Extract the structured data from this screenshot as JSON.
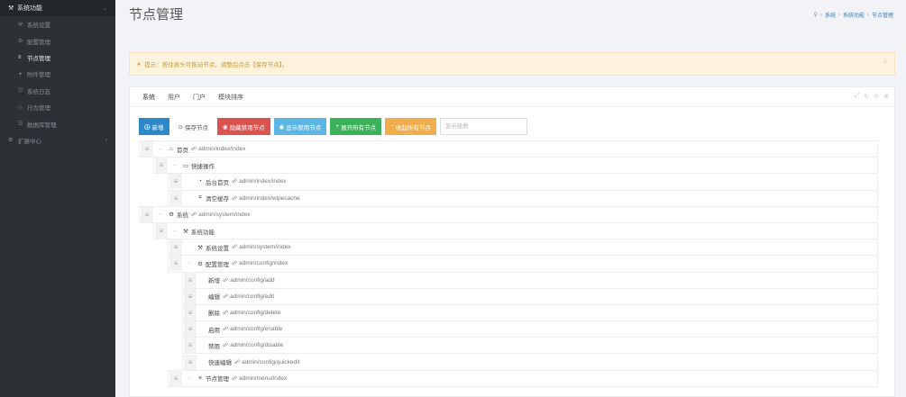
{
  "sidebar": {
    "header": {
      "icon": "wrench-icon",
      "label": "系统功能",
      "arrow": "⌄"
    },
    "items": [
      {
        "icon": "wrench-icon",
        "label": "系统设置",
        "active": false
      },
      {
        "icon": "gear-icon",
        "label": "配置管理",
        "active": false
      },
      {
        "icon": "list-icon",
        "label": "节点管理",
        "active": true
      },
      {
        "icon": "puzzle-icon",
        "label": "附件管理",
        "active": false
      },
      {
        "icon": "file-icon",
        "label": "系统日志",
        "active": false
      },
      {
        "icon": "shield-icon",
        "label": "行为管理",
        "active": false
      },
      {
        "icon": "db-icon",
        "label": "数据库管理",
        "active": false
      }
    ],
    "group": {
      "icon": "gear-icon",
      "label": "扩展中心",
      "arrow": "‹"
    }
  },
  "page": {
    "title": "节点管理",
    "breadcrumb": [
      "系统",
      "系统功能",
      "节点管理"
    ]
  },
  "alert": {
    "text": "提示：按住表头可拖动节点，调整后点击【保存节点】。",
    "close": "×"
  },
  "tabs": [
    "系统",
    "用户",
    "门户",
    "模块排序"
  ],
  "card_tools": [
    "⤢",
    "↻",
    "⊖",
    "⊗"
  ],
  "toolbar": {
    "add": "新增",
    "save": "保存节点",
    "hide": "隐藏禁用节点",
    "show": "显示禁用节点",
    "expand": "展开所有节点",
    "collapse": "收起所有节点",
    "search_placeholder": "显示级数"
  },
  "tree": [
    {
      "level": 0,
      "toggle": "-",
      "icon": "home-icon",
      "title": "首页",
      "path": "admin/index/index"
    },
    {
      "level": 1,
      "toggle": "-",
      "icon": "folder-icon",
      "title": "快捷操作",
      "path": ""
    },
    {
      "level": 2,
      "toggle": "",
      "icon": "dashboard-icon",
      "title": "后台首页",
      "path": "admin/index/index"
    },
    {
      "level": 2,
      "toggle": "",
      "icon": "trash-icon",
      "title": "清空缓存",
      "path": "admin/index/wipecache"
    },
    {
      "level": 0,
      "toggle": "-",
      "icon": "gear-icon",
      "title": "系统",
      "path": "admin/system/index"
    },
    {
      "level": 1,
      "toggle": "-",
      "icon": "wrench-icon",
      "title": "系统功能",
      "path": ""
    },
    {
      "level": 2,
      "toggle": "",
      "icon": "wrench-icon",
      "title": "系统设置",
      "path": "admin/system/index"
    },
    {
      "level": 2,
      "toggle": "-",
      "icon": "gears-icon",
      "title": "配置管理",
      "path": "admin/config/index"
    },
    {
      "level": 3,
      "toggle": "",
      "icon": "",
      "title": "新增",
      "path": "admin/config/add"
    },
    {
      "level": 3,
      "toggle": "",
      "icon": "",
      "title": "编辑",
      "path": "admin/config/edit"
    },
    {
      "level": 3,
      "toggle": "",
      "icon": "",
      "title": "删除",
      "path": "admin/config/delete"
    },
    {
      "level": 3,
      "toggle": "",
      "icon": "",
      "title": "启用",
      "path": "admin/config/enable"
    },
    {
      "level": 3,
      "toggle": "",
      "icon": "",
      "title": "禁用",
      "path": "admin/config/disable"
    },
    {
      "level": 3,
      "toggle": "",
      "icon": "",
      "title": "快速编辑",
      "path": "admin/config/quickedit"
    },
    {
      "level": 2,
      "toggle": "-",
      "icon": "list-icon",
      "title": "节点管理",
      "path": "admin/menu/index"
    }
  ]
}
